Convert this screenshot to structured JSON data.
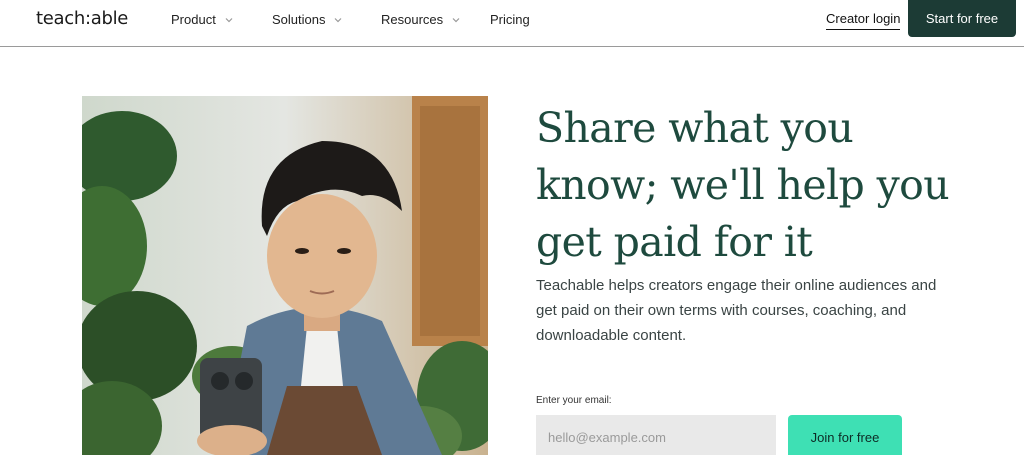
{
  "header": {
    "logo_text": "teach:able",
    "nav": [
      {
        "label": "Product",
        "has_dropdown": true
      },
      {
        "label": "Solutions",
        "has_dropdown": true
      },
      {
        "label": "Resources",
        "has_dropdown": true
      },
      {
        "label": "Pricing",
        "has_dropdown": false
      }
    ],
    "creator_login": "Creator login",
    "start_button": "Start for free"
  },
  "hero": {
    "headline": "Share what you know; we'll help you get paid for it",
    "subtext": "Teachable helps creators engage their online audiences and get paid on their own terms with courses, coaching, and downloadable content.",
    "email_label": "Enter your email:",
    "email_placeholder": "hello@example.com",
    "join_button": "Join for free"
  },
  "colors": {
    "brand_dark": "#1c3b35",
    "headline": "#1e4a3e",
    "accent": "#3ee0b4"
  }
}
